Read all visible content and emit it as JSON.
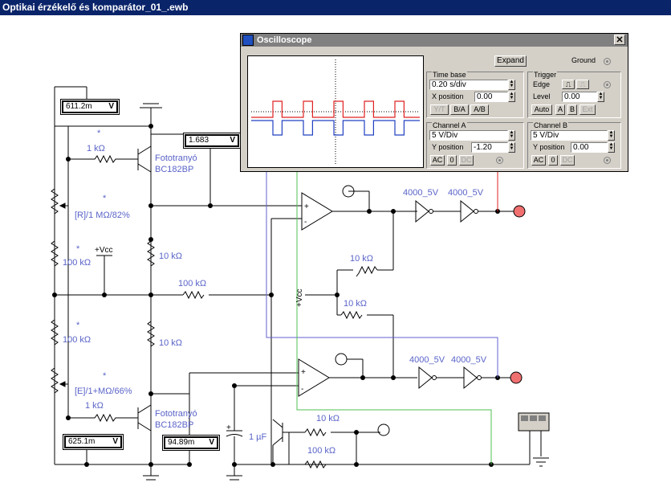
{
  "window": {
    "title": "Optikai érzékelő és komparátor_01_.ewb"
  },
  "meters": {
    "m1": {
      "value": "611.2m",
      "unit": "V"
    },
    "m2": {
      "value": "1.683",
      "unit": "V"
    },
    "m3": {
      "value": "625.1m",
      "unit": "V"
    },
    "m4": {
      "value": "94.89m",
      "unit": "V"
    }
  },
  "labels": {
    "r1k_top": "1 kΩ",
    "photo_top_name": "Fototranyó",
    "photo_top_part": "BC182BP",
    "pot_top": "[R]/1 MΩ/82%",
    "r100k_left_top": "100 kΩ",
    "r10k_top": "10 kΩ",
    "vcc_left": "+Vcc",
    "r100k_mid": "100 kΩ",
    "r100k_left_bot": "100 kΩ",
    "r10k_bot": "10 kΩ",
    "pot_bot": "[E]/1+MΩ/66%",
    "r1k_bot": "1 kΩ",
    "photo_bot_name": "Fototranyó",
    "photo_bot_part": "BC182BP",
    "vcc_right": "+Vcc",
    "fb_top": "10 kΩ",
    "fb_bot": "10 kΩ",
    "gate_top_1": "4000_5V",
    "gate_top_2": "4000_5V",
    "gate_bot_1": "4000_5V",
    "gate_bot_2": "4000_5V",
    "cap": "1 µF",
    "r10k_bottom": "10 kΩ",
    "r100k_bottom": "100 kΩ",
    "star": "*"
  },
  "scope": {
    "title": "Oscilloscope",
    "expand": "Expand",
    "ground": "Ground",
    "timebase": {
      "title": "Time base",
      "value": "0.20 s/div",
      "xpos_label": "X position",
      "xpos": "0.00",
      "yt": "Y/T",
      "ba": "B/A",
      "ab": "A/B"
    },
    "trigger": {
      "title": "Trigger",
      "edge": "Edge",
      "level_label": "Level",
      "level": "0.00",
      "auto": "Auto",
      "a": "A",
      "b": "B",
      "ext": "Ext"
    },
    "channel_a": {
      "title": "Channel A",
      "value": "5 V/Div",
      "ypos_label": "Y position",
      "ypos": "-1.20",
      "ac": "AC",
      "zero": "0",
      "dc": "DC"
    },
    "channel_b": {
      "title": "Channel B",
      "value": "5 V/Div",
      "ypos_label": "Y position",
      "ypos": "0.00",
      "ac": "AC",
      "zero": "0",
      "dc": "DC"
    },
    "colors": {
      "trace_a": "#e02020",
      "trace_b": "#2040c0"
    }
  }
}
